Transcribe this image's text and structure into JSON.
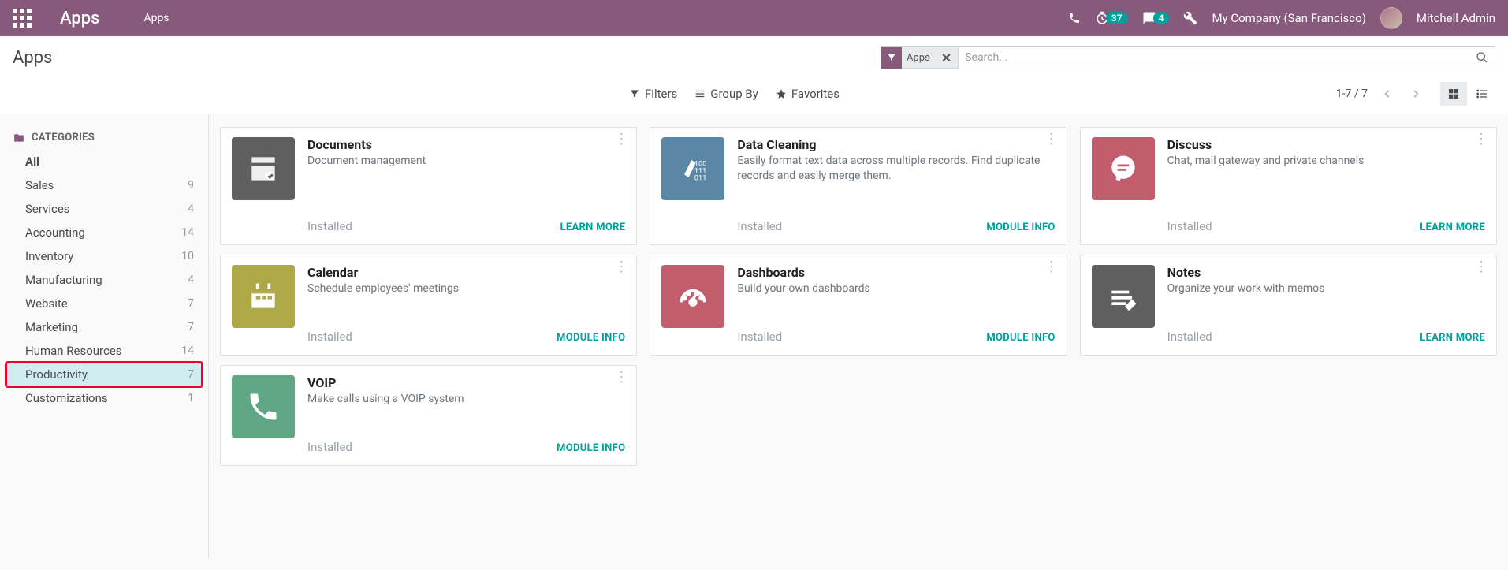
{
  "header": {
    "title": "Apps",
    "breadcrumb": "Apps",
    "timer_badge": "37",
    "messages_badge": "4",
    "company": "My Company (San Francisco)",
    "user": "Mitchell Admin"
  },
  "control_panel": {
    "title": "Apps",
    "search_chip": "Apps",
    "search_placeholder": "Search...",
    "filters_label": "Filters",
    "groupby_label": "Group By",
    "favorites_label": "Favorites",
    "pager": "1-7 / 7"
  },
  "sidebar": {
    "heading": "CATEGORIES",
    "items": [
      {
        "label": "All",
        "count": ""
      },
      {
        "label": "Sales",
        "count": "9"
      },
      {
        "label": "Services",
        "count": "4"
      },
      {
        "label": "Accounting",
        "count": "14"
      },
      {
        "label": "Inventory",
        "count": "10"
      },
      {
        "label": "Manufacturing",
        "count": "4"
      },
      {
        "label": "Website",
        "count": "7"
      },
      {
        "label": "Marketing",
        "count": "7"
      },
      {
        "label": "Human Resources",
        "count": "14"
      },
      {
        "label": "Productivity",
        "count": "7"
      },
      {
        "label": "Customizations",
        "count": "1"
      }
    ]
  },
  "cards": [
    {
      "title": "Documents",
      "desc": "Document management",
      "status": "Installed",
      "link": "LEARN MORE"
    },
    {
      "title": "Data Cleaning",
      "desc": "Easily format text data across multiple records. Find duplicate records and easily merge them.",
      "status": "Installed",
      "link": "MODULE INFO"
    },
    {
      "title": "Discuss",
      "desc": "Chat, mail gateway and private channels",
      "status": "Installed",
      "link": "LEARN MORE"
    },
    {
      "title": "Calendar",
      "desc": "Schedule employees' meetings",
      "status": "Installed",
      "link": "MODULE INFO"
    },
    {
      "title": "Dashboards",
      "desc": "Build your own dashboards",
      "status": "Installed",
      "link": "MODULE INFO"
    },
    {
      "title": "Notes",
      "desc": "Organize your work with memos",
      "status": "Installed",
      "link": "LEARN MORE"
    },
    {
      "title": "VOIP",
      "desc": "Make calls using a VOIP system",
      "status": "Installed",
      "link": "MODULE INFO"
    }
  ]
}
